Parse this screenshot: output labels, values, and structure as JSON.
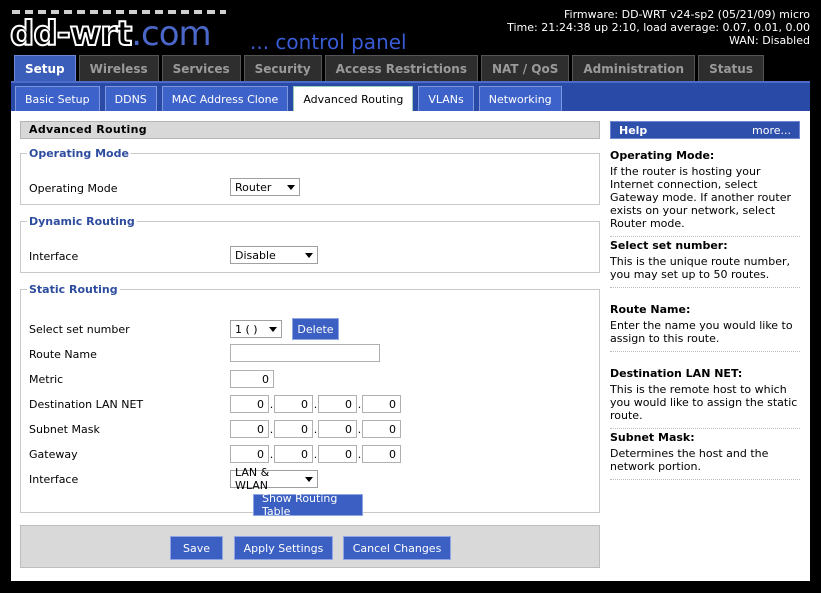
{
  "header": {
    "brand": "dd-wrt",
    "brand_domain": ".com",
    "tagline": "... control panel",
    "firmware": "Firmware: DD-WRT v24-sp2 (05/21/09) micro",
    "time": "Time: 21:24:38 up 2:10, load average: 0.07, 0.01, 0.00",
    "wan": "WAN: Disabled"
  },
  "main_tabs": [
    "Setup",
    "Wireless",
    "Services",
    "Security",
    "Access Restrictions",
    "NAT / QoS",
    "Administration",
    "Status"
  ],
  "sub_tabs": [
    "Basic Setup",
    "DDNS",
    "MAC Address Clone",
    "Advanced Routing",
    "VLANs",
    "Networking"
  ],
  "page": {
    "title": "Advanced Routing",
    "operating_mode": {
      "legend": "Operating Mode",
      "label": "Operating Mode",
      "value": "Router"
    },
    "dynamic_routing": {
      "legend": "Dynamic Routing",
      "label": "Interface",
      "value": "Disable"
    },
    "static_routing": {
      "legend": "Static Routing",
      "set_label": "Select set number",
      "set_value": "1 ( )",
      "delete_label": "Delete",
      "route_name_label": "Route Name",
      "route_name_value": "",
      "metric_label": "Metric",
      "metric_value": "0",
      "dest_label": "Destination LAN NET",
      "dest": [
        "0",
        "0",
        "0",
        "0"
      ],
      "mask_label": "Subnet Mask",
      "mask": [
        "0",
        "0",
        "0",
        "0"
      ],
      "gateway_label": "Gateway",
      "gateway": [
        "0",
        "0",
        "0",
        "0"
      ],
      "iface_label": "Interface",
      "iface_value": "LAN & WLAN",
      "show_table_label": "Show Routing Table"
    },
    "buttons": {
      "save": "Save",
      "apply": "Apply Settings",
      "cancel": "Cancel Changes"
    }
  },
  "help": {
    "title": "Help",
    "more": "more...",
    "items": [
      {
        "title": "Operating Mode:",
        "text": "If the router is hosting your Internet connection, select Gateway mode. If another router exists on your network, select Router mode."
      },
      {
        "title": "Select set number:",
        "text": "This is the unique route number, you may set up to 50 routes."
      },
      {
        "title": "Route Name:",
        "text": "Enter the name you would like to assign to this route."
      },
      {
        "title": "Destination LAN NET:",
        "text": "This is the remote host to which you would like to assign the static route."
      },
      {
        "title": "Subnet Mask:",
        "text": "Determines the host and the network portion."
      }
    ]
  },
  "colors": {
    "accent": "#3b5eba",
    "subbar": "#2a4aa8",
    "legend": "#2e4d9f"
  }
}
